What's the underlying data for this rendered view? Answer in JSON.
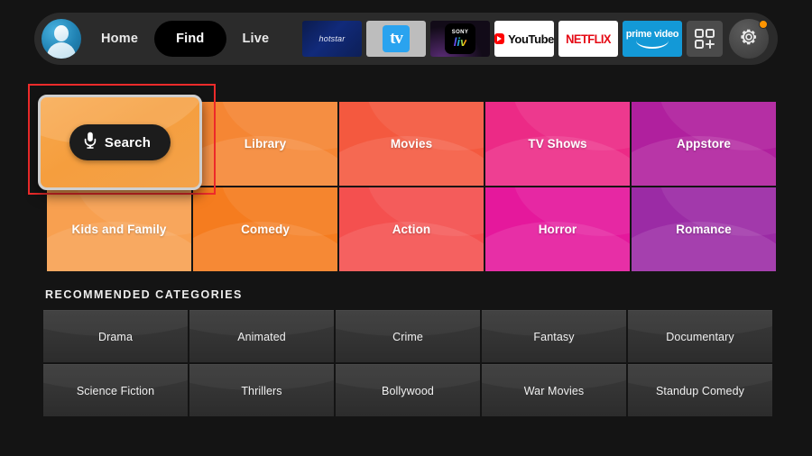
{
  "topbar": {
    "avatar_name": "profile-avatar",
    "nav": [
      {
        "label": "Home",
        "active": false
      },
      {
        "label": "Find",
        "active": true
      },
      {
        "label": "Live",
        "active": false
      }
    ],
    "apps": [
      {
        "name": "hotstar",
        "label": "hotstar"
      },
      {
        "name": "apple-tv",
        "label": "tv"
      },
      {
        "name": "sony-liv",
        "label": "SONY",
        "label2": "liv"
      },
      {
        "name": "youtube",
        "label": "YouTube"
      },
      {
        "name": "netflix",
        "label": "NETFLIX"
      },
      {
        "name": "prime-video",
        "label": "prime video"
      },
      {
        "name": "app-grid",
        "label": ""
      },
      {
        "name": "settings-gear",
        "label": ""
      }
    ],
    "notification_dot_color": "#ff9500"
  },
  "search_tile": {
    "label": "Search",
    "icon": "microphone-icon",
    "focused": true,
    "selection_color": "#ef2b2b",
    "tile_color": "#f5a34a"
  },
  "tiles": {
    "row1": [
      {
        "label": "Library",
        "color": "#f58634"
      },
      {
        "label": "Movies",
        "color": "#f4593f"
      },
      {
        "label": "TV Shows",
        "color": "#ec2a86"
      },
      {
        "label": "Appstore",
        "color": "#b0209e"
      }
    ],
    "row2": [
      {
        "label": "Kids and Family",
        "color": "#f8a050"
      },
      {
        "label": "Comedy",
        "color": "#f57c1f"
      },
      {
        "label": "Action",
        "color": "#f4504f"
      },
      {
        "label": "Horror",
        "color": "#e5189c"
      },
      {
        "label": "Romance",
        "color": "#9b2ba5"
      }
    ]
  },
  "recommended": {
    "title": "RECOMMENDED CATEGORIES",
    "row1": [
      {
        "label": "Drama"
      },
      {
        "label": "Animated"
      },
      {
        "label": "Crime"
      },
      {
        "label": "Fantasy"
      },
      {
        "label": "Documentary"
      }
    ],
    "row2": [
      {
        "label": "Science Fiction"
      },
      {
        "label": "Thrillers"
      },
      {
        "label": "Bollywood"
      },
      {
        "label": "War Movies"
      },
      {
        "label": "Standup Comedy"
      }
    ]
  }
}
